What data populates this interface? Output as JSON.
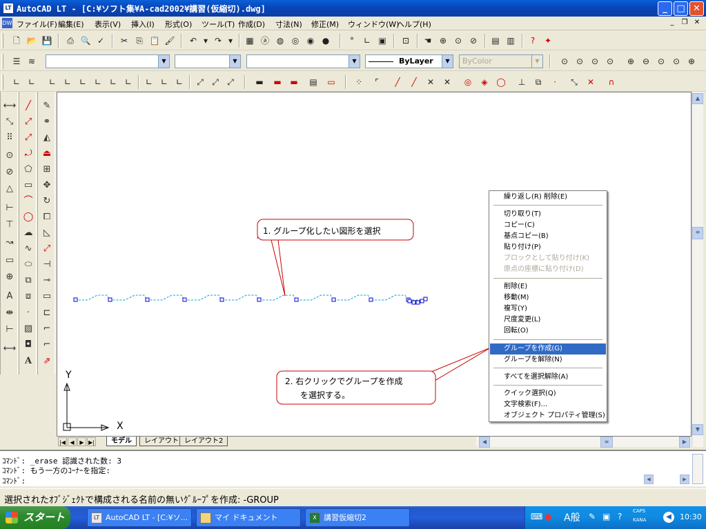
{
  "window": {
    "title": "AutoCAD LT - [C:¥ソフト集¥A-cad2002¥講習(仮縮切).dwg]",
    "app_icon": "LT"
  },
  "menu": [
    "ファイル(F)",
    "編集(E)",
    "表示(V)",
    "挿入(I)",
    "形式(O)",
    "ツール(T)",
    "作成(D)",
    "寸法(N)",
    "修正(M)",
    "ウィンドウ(W)",
    "ヘルプ(H)"
  ],
  "toolbar2": {
    "linetype": "ByLayer",
    "color": "ByColor"
  },
  "layout_tabs": [
    "モデル",
    "レイアウト1",
    "レイアウト2"
  ],
  "canvas": {
    "axis_x": "X",
    "axis_y": "Y"
  },
  "callouts": {
    "first": "1. グループ化したい図形を選択",
    "second_line1": "2. 右クリックでグループを作成",
    "second_line2": "を選択する。"
  },
  "context_menu": {
    "items": [
      {
        "label": "繰り返し(R) 削除(E)",
        "state": "normal"
      },
      {
        "label": "切り取り(T)",
        "state": "normal"
      },
      {
        "label": "コピー(C)",
        "state": "normal"
      },
      {
        "label": "基点コピー(B)",
        "state": "normal"
      },
      {
        "label": "貼り付け(P)",
        "state": "normal"
      },
      {
        "label": "ブロックとして貼り付け(K)",
        "state": "disabled"
      },
      {
        "label": "原点の座標に貼り付け(D)",
        "state": "disabled"
      },
      {
        "label": "削除(E)",
        "state": "normal"
      },
      {
        "label": "移動(M)",
        "state": "normal"
      },
      {
        "label": "複写(Y)",
        "state": "normal"
      },
      {
        "label": "尺度変更(L)",
        "state": "normal"
      },
      {
        "label": "回転(O)",
        "state": "normal"
      },
      {
        "label": "グループを作成(G)",
        "state": "highlighted"
      },
      {
        "label": "グループを解除(N)",
        "state": "normal"
      },
      {
        "label": "すべてを選択解除(A)",
        "state": "normal"
      },
      {
        "label": "クイック選択(Q)",
        "state": "normal"
      },
      {
        "label": "文字検索(F)...",
        "state": "normal"
      },
      {
        "label": "オブジェクト プロパティ管理(S)",
        "state": "normal"
      }
    ]
  },
  "command": {
    "line1": "ｺﾏﾝﾄﾞ: _erase 認識された数: 3",
    "line2": "ｺﾏﾝﾄﾞ: もう一方のｺｰﾅｰを指定:",
    "line3": "ｺﾏﾝﾄﾞ:"
  },
  "status": "選択されたｵﾌﾞｼﾞｪｸﾄで構成される名前の無いｸﾞﾙｰﾌﾟを作成: -GROUP",
  "taskbar": {
    "start": "スタート",
    "buttons": [
      "AutoCAD LT - [C:¥ソ...",
      "マイ ドキュメント",
      "講習仮縮切2"
    ],
    "tray": {
      "ime": "A般",
      "caps": "CAPS",
      "kana": "KANA",
      "time": "10:30"
    }
  },
  "colors": {
    "highlight": "#316ac5",
    "callout_border": "#cc0000",
    "drawing_line": "#00a0d8"
  }
}
